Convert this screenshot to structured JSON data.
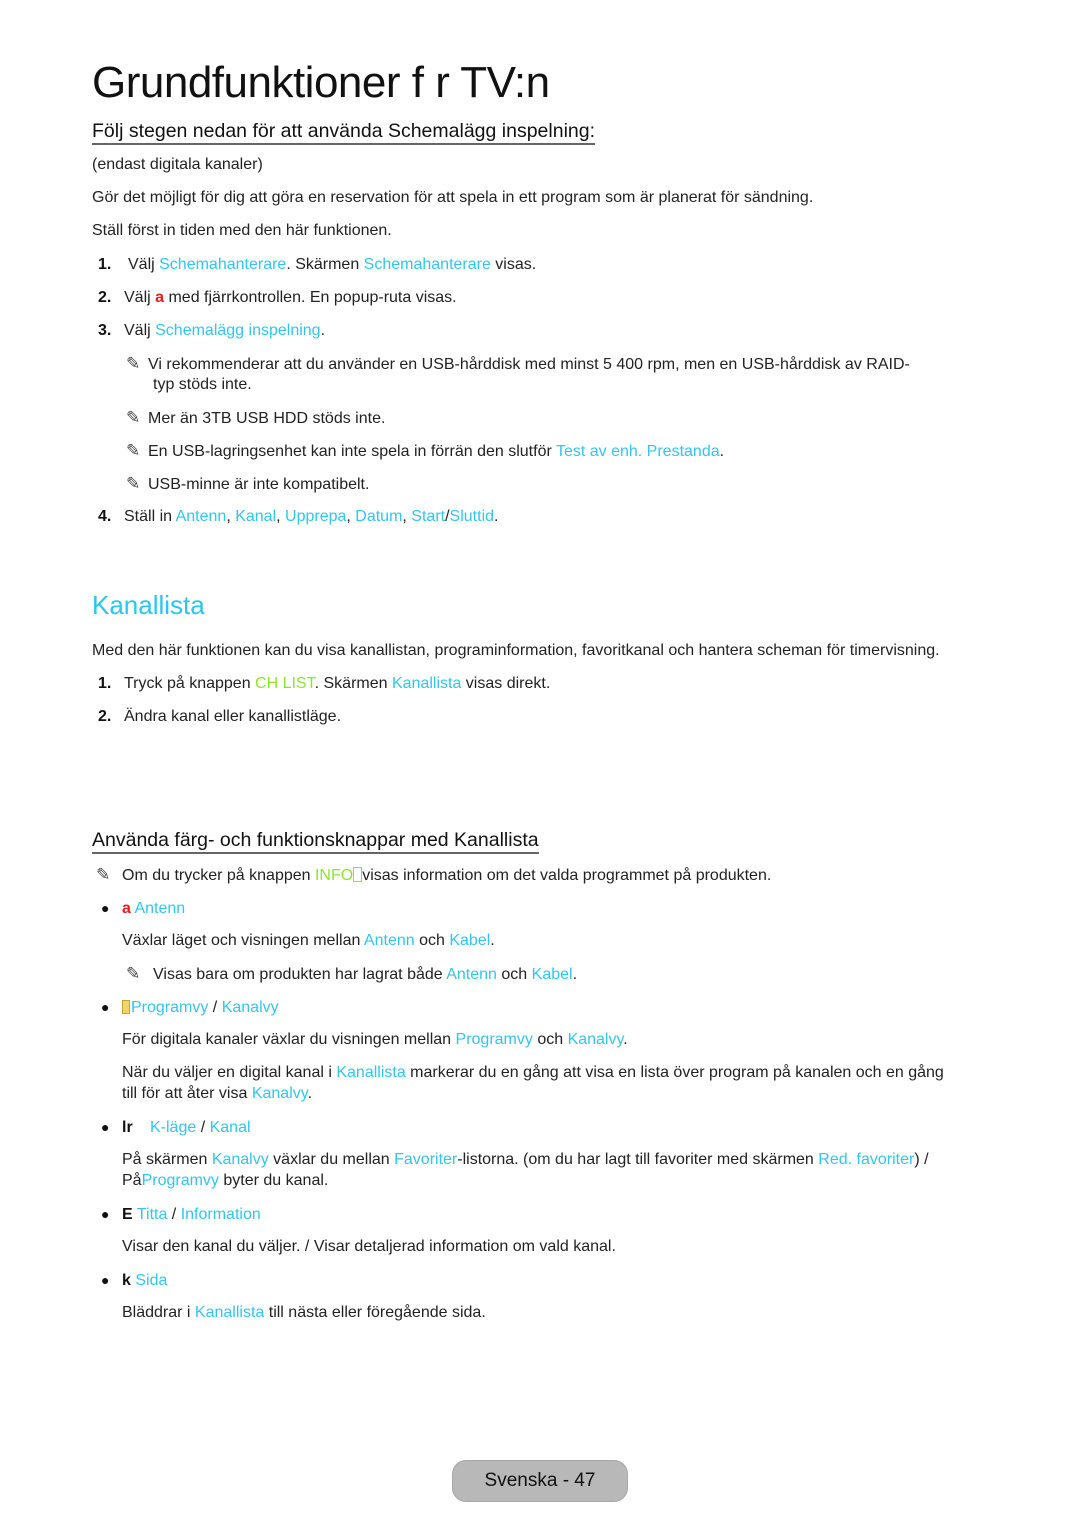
{
  "page": {
    "title": "Grundfunktioner f r TV:n"
  },
  "section1": {
    "heading": "Följ stegen nedan för att använda Schemalägg inspelning:",
    "note_digital": "(endast digitala kanaler)",
    "intro1": "Gör det möjligt för dig att göra en reservation för att spela in ett program som är planerat för sändning.",
    "intro2": "Ställ först in tiden med den här funktionen.",
    "steps": [
      {
        "num": "1.",
        "parts": [
          "Välj ",
          "Schemahanterare",
          ". Skärmen ",
          "Schemahanterare",
          " visas."
        ]
      },
      {
        "num": "2.",
        "parts": [
          "Välj ",
          "a",
          " med fjärrkontrollen. En popup-ruta visas."
        ]
      },
      {
        "num": "3.",
        "parts": [
          "Välj ",
          "Schemalägg inspelning",
          "."
        ]
      },
      {
        "num": "4.",
        "parts": [
          "Ställ in ",
          "Antenn",
          ", ",
          "Kanal",
          ", ",
          "Upprepa",
          ", ",
          "Datum",
          ", ",
          "Start",
          "/",
          "Sluttid",
          "."
        ]
      }
    ],
    "notes": [
      {
        "line1": "Vi rekommenderar att du använder en USB-hårddisk med minst 5 400 rpm, men en USB-hårddisk av RAID-",
        "line2": "typ stöds inte."
      },
      {
        "text": "Mer än 3TB USB HDD stöds inte."
      },
      {
        "pre": "En USB-lagringsenhet kan inte spela in förrän den slutför ",
        "link": "Test av enh. Prestanda",
        "post": "."
      },
      {
        "text": "USB-minne är inte kompatibelt."
      }
    ]
  },
  "section2": {
    "title": "Kanallista",
    "intro": "Med den här funktionen kan du visa kanallistan, programinformation, favoritkanal och hantera scheman för timervisning.",
    "steps": [
      {
        "num": "1.",
        "pre": "Tryck på knappen ",
        "button": "CH LIST",
        "mid": ". Skärmen ",
        "link": "Kanallista",
        "post": " visas direkt."
      },
      {
        "num": "2.",
        "text": "Ändra kanal eller kanallistläge."
      }
    ]
  },
  "section3": {
    "heading": "Använda färg- och funktionsknappar med Kanallista",
    "info_note": {
      "pre": "Om du trycker på knappen ",
      "button": "INFO",
      "post": "visas information om det valda programmet på produkten."
    },
    "items": [
      {
        "key": "a",
        "label": "Antenn",
        "desc": [
          "Växlar läget och visningen mellan ",
          "Antenn",
          " och ",
          "Kabel",
          "."
        ],
        "note": [
          "Visas bara om produkten har lagrat både ",
          "Antenn",
          " och ",
          "Kabel",
          "."
        ]
      },
      {
        "key": "",
        "label1": "Programvy",
        "sep": " / ",
        "label2": "Kanalvy",
        "desc": [
          "För digitala kanaler växlar du visningen mellan ",
          "Programvy",
          " och ",
          "Kanalvy",
          "."
        ],
        "desc2_line1": [
          "När du väljer en digital kanal i ",
          "Kanallista",
          " markerar du en gång att visa en lista över program på kanalen och en gång"
        ],
        "desc2_line2": [
          "till för att åter visa ",
          "Kanalvy",
          "."
        ]
      },
      {
        "key": "lr",
        "label1": "K-läge",
        "sep": " / ",
        "label2": "Kanal",
        "desc_line1": [
          "På skärmen ",
          "Kanalvy",
          " växlar du mellan ",
          "Favoriter",
          "-listorna. (om du har lagt till favoriter med skärmen ",
          "Red. favoriter",
          ") /"
        ],
        "desc_line2": [
          "På",
          "Programvy",
          " byter du kanal."
        ]
      },
      {
        "key": "E",
        "label1": "Titta",
        "sep": " / ",
        "label2": "Information",
        "desc": "Visar den kanal du väljer. / Visar detaljerad information om vald kanal."
      },
      {
        "key": "k",
        "label": "Sida",
        "desc": [
          "Bläddrar i ",
          "Kanallista",
          " till nästa eller föregående sida."
        ]
      }
    ]
  },
  "footer": {
    "page_label": "Svenska - 47"
  },
  "icons": {
    "note": "✎",
    "bullet": "●"
  },
  "colors": {
    "highlight": "#33c5f0",
    "button_green": "#8ce62b",
    "key_red": "#ee1c1c"
  }
}
